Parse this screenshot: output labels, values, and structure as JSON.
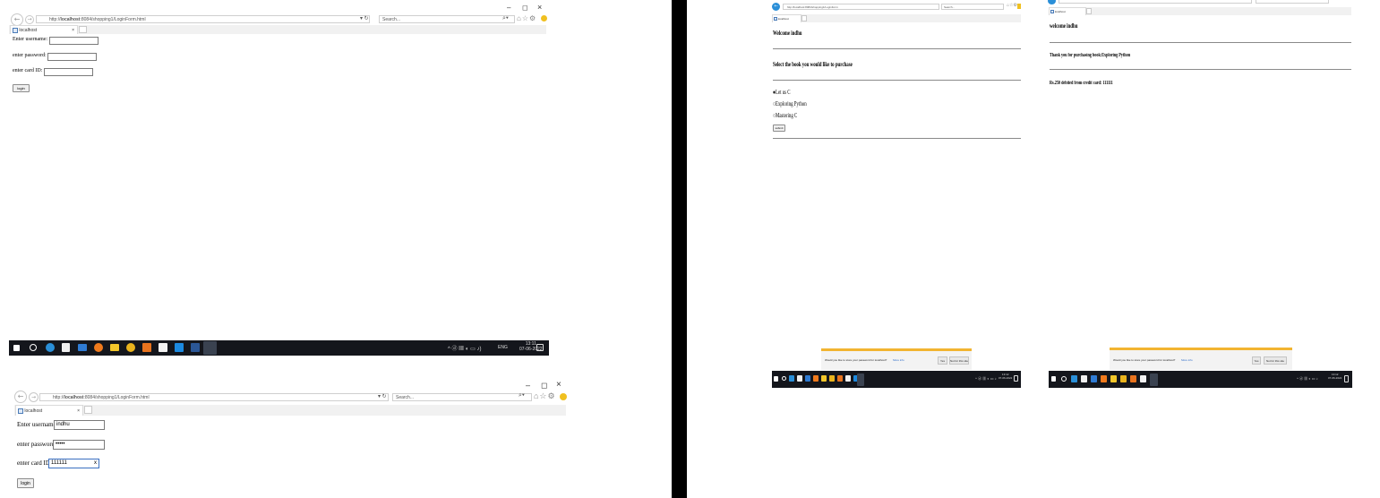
{
  "window_controls": {
    "minimize": "–",
    "maximize": "◻",
    "close": "×"
  },
  "browser": {
    "url": "http://localhost:8084/shopping1/LoginForm.html",
    "url_prefix": "http://",
    "url_host": "localhost",
    "url_rest": ":8084/shopping1/LoginForm.html",
    "search_placeholder": "Search...",
    "tab_title": "localhost",
    "tab_close": "×"
  },
  "login_empty": {
    "username_label": "Enter username:",
    "password_label": "enter password:",
    "card_label": "enter card ID:",
    "login_button": "login"
  },
  "login_filled": {
    "username_label": "Enter username:",
    "username_value": "indhu",
    "password_label": "enter password:",
    "password_value": "•••••",
    "card_label": "enter card ID:",
    "card_value": "111111",
    "card_clear": "x",
    "login_button": "login"
  },
  "purchase_page": {
    "url": "http://localhost:8084/shopping1/LoginForm",
    "search_placeholder": "Search...",
    "tab_title": "localhost",
    "welcome": "Welcome indhu",
    "prompt": "Select the book you would like to purchase",
    "options": [
      "Let us C",
      "Exploring Python",
      "Mastering C"
    ],
    "selected_index": 0,
    "submit_button": "submit",
    "notification": {
      "text": "Would you like to store your password for localhost?",
      "link": "More info",
      "yes": "Yes",
      "no": "Not for this site",
      "close": "×"
    }
  },
  "confirm_page": {
    "tab_title": "localhost",
    "welcome": "welcome indhu",
    "thanks": "Thank you for purchasing book:Exploring Python",
    "debited": "Rs.250 debited from credit card: 111111",
    "notification": {
      "text": "Would you like to store your password for localhost?",
      "link": "More info",
      "yes": "Yes",
      "no": "Not for this site",
      "close": "×"
    }
  },
  "taskbar": {
    "language": "ENG",
    "time": "13:11",
    "date": "07-06-2022",
    "small_time": "13:12",
    "small_date": "07-06-2022"
  },
  "colors": {
    "taskbar": "#14161c",
    "divider": "#000000",
    "notify_accent": "#f2b431",
    "link": "#2a6ac8"
  }
}
